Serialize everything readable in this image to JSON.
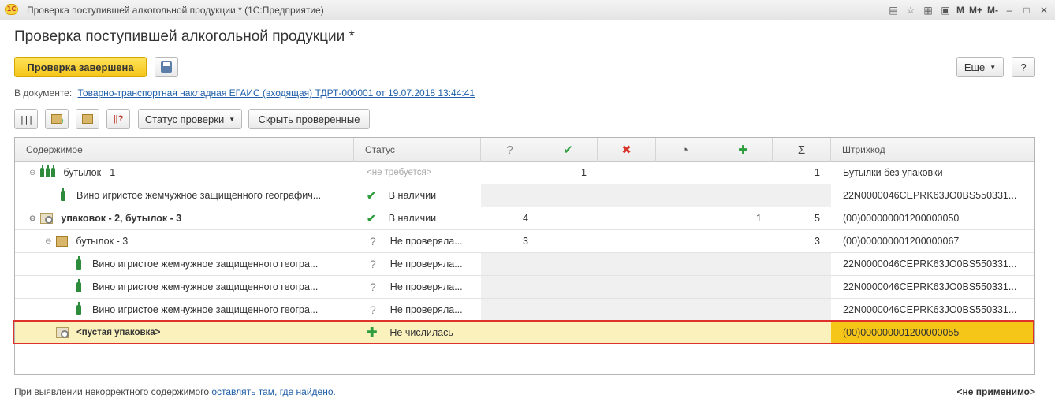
{
  "window": {
    "title": "Проверка поступившей алкогольной продукции * (1С:Предприятие)",
    "logo_text": "1С",
    "toolbar_labels": [
      "M",
      "M+",
      "M-"
    ]
  },
  "form": {
    "heading": "Проверка поступившей алкогольной продукции *",
    "primary_button": "Проверка завершена",
    "more_button": "Еще",
    "help_button": "?"
  },
  "document": {
    "label": "В документе:",
    "link": "Товарно-транспортная накладная ЕГАИС (входящая) ТДРТ-000001 от 19.07.2018 13:44:41"
  },
  "toolbar": {
    "status_button": "Статус проверки",
    "hide_button": "Скрыть проверенные"
  },
  "table": {
    "columns": {
      "content": "Содержимое",
      "status": "Статус",
      "unknown": "?",
      "checked": "✔",
      "missing": "✖",
      "partial": "◔",
      "extra": "✚",
      "total": "Σ",
      "barcode": "Штрихкод"
    },
    "rows": [
      {
        "content": "бутылок -  1",
        "status": "<не требуется>",
        "unknown": "",
        "checked": "1",
        "missing": "",
        "partial": "",
        "extra": "",
        "total": "1",
        "barcode": "Бутылки без упаковки"
      },
      {
        "content": "Вино игристое жемчужное защищенного географич...",
        "status": "В наличии",
        "unknown": "",
        "checked": "",
        "missing": "",
        "partial": "",
        "extra": "",
        "total": "",
        "barcode": "22N0000046CEPRK63JO0BS550331..."
      },
      {
        "content": "упаковок - 2, бутылок  -  3",
        "status": "В наличии",
        "unknown": "4",
        "checked": "",
        "missing": "",
        "partial": "",
        "extra": "1",
        "total": "5",
        "barcode": "(00)000000001200000050"
      },
      {
        "content": "бутылок -  3",
        "status": "Не проверяла...",
        "unknown": "3",
        "checked": "",
        "missing": "",
        "partial": "",
        "extra": "",
        "total": "3",
        "barcode": "(00)000000001200000067"
      },
      {
        "content": "Вино игристое жемчужное защищенного геогра...",
        "status": "Не проверяла...",
        "unknown": "",
        "checked": "",
        "missing": "",
        "partial": "",
        "extra": "",
        "total": "",
        "barcode": "22N0000046CEPRK63JO0BS550331..."
      },
      {
        "content": "Вино игристое жемчужное защищенного геогра...",
        "status": "Не проверяла...",
        "unknown": "",
        "checked": "",
        "missing": "",
        "partial": "",
        "extra": "",
        "total": "",
        "barcode": "22N0000046CEPRK63JO0BS550331..."
      },
      {
        "content": "Вино игристое жемчужное защищенного геогра...",
        "status": "Не проверяла...",
        "unknown": "",
        "checked": "",
        "missing": "",
        "partial": "",
        "extra": "",
        "total": "",
        "barcode": "22N0000046CEPRK63JO0BS550331..."
      },
      {
        "content": "<пустая упаковка>",
        "status": "Не числилась",
        "unknown": "",
        "checked": "",
        "missing": "",
        "partial": "",
        "extra": "",
        "total": "",
        "barcode": "(00)000000001200000055"
      }
    ]
  },
  "footer": {
    "text": "При выявлении некорректного содержимого",
    "link": "оставлять там, где найдено.",
    "right": "<не применимо>"
  },
  "colors": {
    "primary": "#f5c518",
    "link": "#1f5fa8",
    "selection_border": "#e0322c",
    "ok_green": "#2e9e3c"
  }
}
